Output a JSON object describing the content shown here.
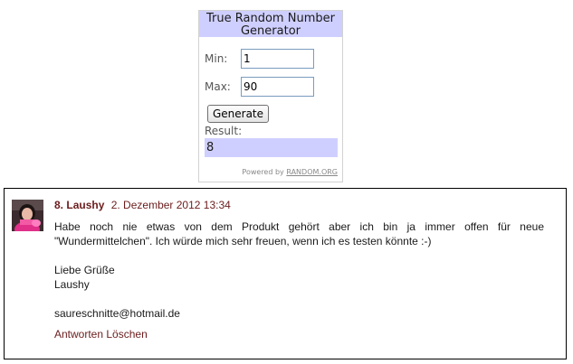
{
  "rng_widget": {
    "title": "True Random Number Generator",
    "min_label": "Min:",
    "min_value": "1",
    "max_label": "Max:",
    "max_value": "90",
    "generate_label": "Generate",
    "result_label": "Result:",
    "result_value": "8",
    "powered_by_text": "Powered by",
    "powered_by_link": "RANDOM.ORG",
    "colors": {
      "header_bg": "#cfcfff",
      "result_bg": "#cfcfff"
    }
  },
  "comment": {
    "number": "8.",
    "author": "Laushy",
    "date": "2. Dezember 2012 13:34",
    "body_paragraph": "Habe noch nie etwas von dem Produkt gehört aber ich bin ja immer offen für neue \"Wundermittelchen\". Ich würde mich sehr freuen, wenn ich es testen könnte :-)",
    "greeting": "Liebe Grüße",
    "signature": "Laushy",
    "email": "saureschnitte@hotmail.de",
    "reply_label": "Antworten",
    "delete_label": "Löschen",
    "colors": {
      "link": "#6b1c1c",
      "border": "#000000"
    }
  }
}
